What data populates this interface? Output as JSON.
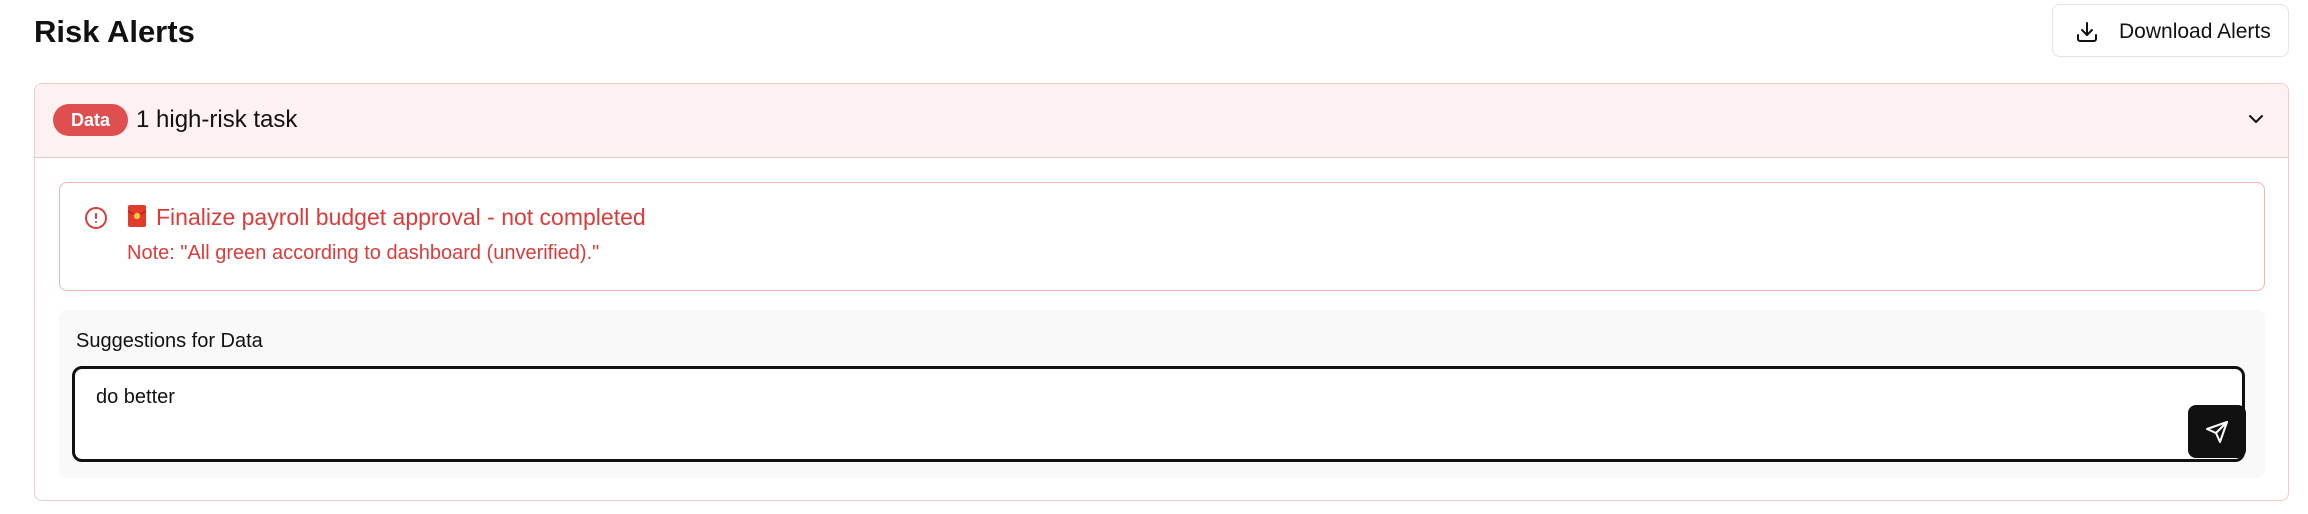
{
  "header": {
    "title": "Risk Alerts",
    "download_label": "Download Alerts"
  },
  "panel": {
    "badge": "Data",
    "summary": "1 high-risk task",
    "expanded": true,
    "alert": {
      "emoji": "🧧",
      "title": "Finalize payroll budget approval - not completed",
      "note": "Note: \"All green according to dashboard (unverified).\""
    },
    "suggestions": {
      "label": "Suggestions for Data",
      "value": "do better"
    }
  },
  "icons": {
    "download": "download-icon",
    "chevron": "chevron-down-icon",
    "alert": "alert-circle-icon",
    "send": "send-icon"
  },
  "colors": {
    "accent_red": "#dc3b3b",
    "badge_red": "#e04f4f",
    "header_bg": "#fdf1f1",
    "border_red": "#f3c9c9",
    "send_bg": "#111111"
  }
}
